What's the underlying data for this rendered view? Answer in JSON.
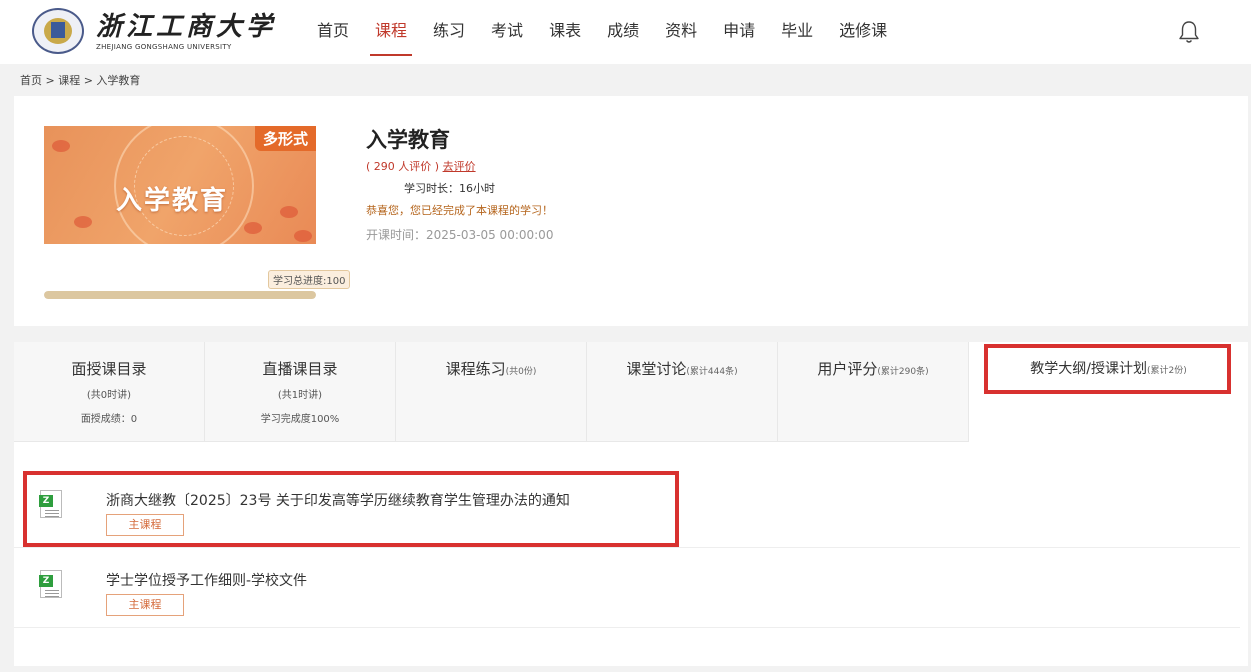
{
  "header": {
    "logo_cn": "浙江工商大学",
    "logo_en": "ZHEJIANG GONGSHANG UNIVERSITY",
    "nav": [
      "首页",
      "课程",
      "练习",
      "考试",
      "课表",
      "成绩",
      "资料",
      "申请",
      "毕业",
      "选修课"
    ],
    "active_nav": "课程",
    "bell_icon": "bell-icon"
  },
  "breadcrumb": "首页 > 课程 > 入学教育",
  "course": {
    "cover_text": "入学教育",
    "cover_tag": "多形式",
    "title": "入学教育",
    "rating_prefix": "( 290 人评价 )",
    "rating_link": "去评价",
    "study_time": "学习时长：16小时",
    "congrats": "恭喜您，您已经完成了本课程的学习！",
    "start_time": "开课时间：2025-03-05 00:00:00",
    "progress_label": "学习总进度:100",
    "progress_percent": 100
  },
  "tabs": [
    {
      "title": "面授课目录",
      "small": "",
      "sub": "(共0时讲)",
      "sub2": "面授成绩：0"
    },
    {
      "title": "直播课目录",
      "small": "",
      "sub": "(共1时讲)",
      "sub2": "学习完成度100%"
    },
    {
      "title": "课程练习",
      "small": "(共0份)",
      "sub": "",
      "sub2": ""
    },
    {
      "title": "课堂讨论",
      "small": "(累计444条)",
      "sub": "",
      "sub2": ""
    },
    {
      "title": "用户评分",
      "small": "(累计290条)",
      "sub": "",
      "sub2": ""
    },
    {
      "title": "教学大纲/授课计划",
      "small": "(累计2份)",
      "sub": "",
      "sub2": ""
    }
  ],
  "documents": [
    {
      "title": "浙商大继教〔2025〕23号 关于印发高等学历继续教育学生管理办法的通知",
      "tag": "主课程"
    },
    {
      "title": "学士学位授予工作细则-学校文件",
      "tag": "主课程"
    }
  ],
  "colors": {
    "accent": "#c0392b",
    "highlight": "#d8312f",
    "doc_icon": "#2e9e3e"
  }
}
